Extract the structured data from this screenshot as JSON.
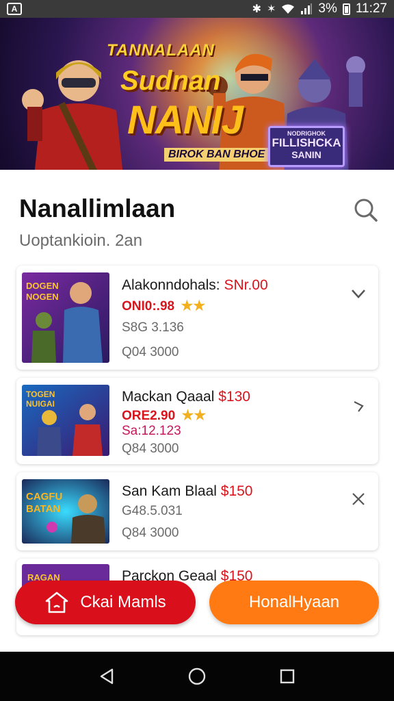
{
  "status_bar": {
    "app_badge": "A",
    "battery": "3%",
    "time": "11:27",
    "icons": [
      "bluetooth-icon",
      "vibrate-icon",
      "wifi-icon",
      "signal-icon",
      "battery-icon"
    ]
  },
  "banner": {
    "line1": "TANNALAAN",
    "line2": "Sudnan",
    "line3": "NANIJ",
    "tagline": "BIROK BAN BHOE",
    "sign_top": "NODRIGHOK",
    "sign_mid": "FILLISHCKA",
    "sign_bottom": "SANIN"
  },
  "header": {
    "title": "Nanallimlaan",
    "subtitle": "Uoptankioin. 2an"
  },
  "cards": [
    {
      "name": "Alakonndohals:",
      "price": "SNr.00",
      "line1": "ONI0:.98",
      "line2": "S8G 3.136",
      "line3": "Q04 3000",
      "action": "chevron-down-icon",
      "stars": 2
    },
    {
      "name": "Mackan Qaaal",
      "price": "$130",
      "line1": "ORE2.90",
      "line2": "Sa:12.123",
      "line3": "Q84 3000",
      "action": "arrow-icon",
      "stars": 2
    },
    {
      "name": "San Kam Blaal",
      "price": "$150",
      "line1": "G48.5.031",
      "line3": "Q84 3000",
      "action": "close-icon"
    },
    {
      "name": "Parckon Geaal",
      "price": "$150"
    }
  ],
  "buttons": {
    "left_label": "Ckai Mamls",
    "right_label": "HonalHyaan"
  },
  "colors": {
    "primary_red": "#d9101c",
    "accent_orange": "#ff7a12",
    "status_bar": "#3a3a3a",
    "nav_bar": "#050505"
  }
}
